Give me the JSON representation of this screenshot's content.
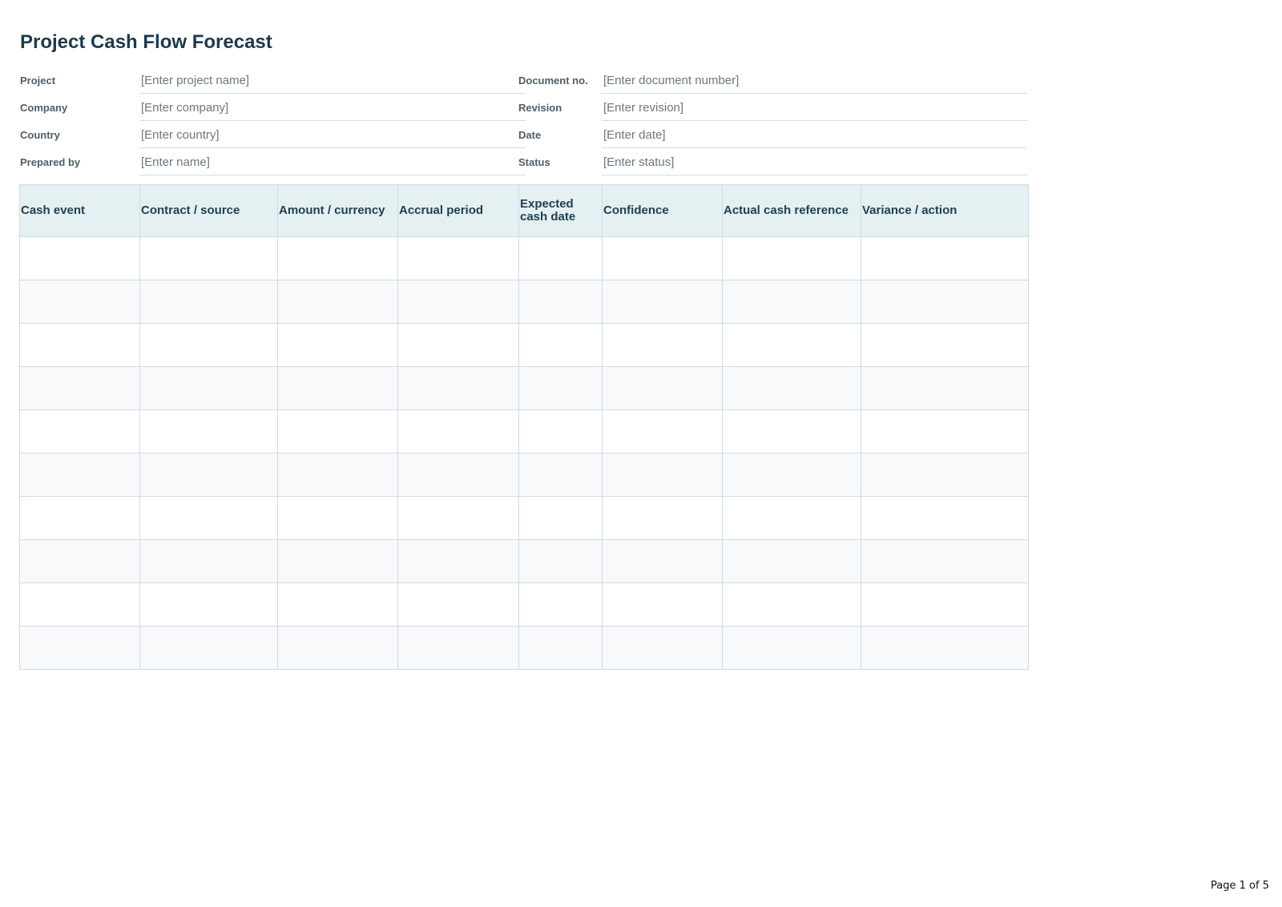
{
  "document": {
    "title": "Project Cash Flow Forecast"
  },
  "meta": {
    "rows": [
      {
        "label": "Project",
        "value": "[Enter project name]",
        "label2": "Document no.",
        "value2": "[Enter document number]"
      },
      {
        "label": "Company",
        "value": "[Enter company]",
        "label2": "Revision",
        "value2": "[Enter revision]"
      },
      {
        "label": "Country",
        "value": "[Enter country]",
        "label2": "Date",
        "value2": "[Enter date]"
      },
      {
        "label": "Prepared by",
        "value": "[Enter name]",
        "label2": "Status",
        "value2": "[Enter status]"
      }
    ]
  },
  "table": {
    "columns": [
      "Cash event",
      "Contract / source",
      "Amount / currency",
      "Accrual period",
      "Expected cash date",
      "Confidence",
      "Actual cash reference",
      "Variance / action"
    ],
    "rows": [
      [
        "",
        "",
        "",
        "",
        "",
        "",
        "",
        ""
      ],
      [
        "",
        "",
        "",
        "",
        "",
        "",
        "",
        ""
      ],
      [
        "",
        "",
        "",
        "",
        "",
        "",
        "",
        ""
      ],
      [
        "",
        "",
        "",
        "",
        "",
        "",
        "",
        ""
      ],
      [
        "",
        "",
        "",
        "",
        "",
        "",
        "",
        ""
      ],
      [
        "",
        "",
        "",
        "",
        "",
        "",
        "",
        ""
      ],
      [
        "",
        "",
        "",
        "",
        "",
        "",
        "",
        ""
      ],
      [
        "",
        "",
        "",
        "",
        "",
        "",
        "",
        ""
      ],
      [
        "",
        "",
        "",
        "",
        "",
        "",
        "",
        ""
      ],
      [
        "",
        "",
        "",
        "",
        "",
        "",
        "",
        ""
      ]
    ]
  },
  "footer": {
    "page_label": "Page 1 of 5"
  }
}
